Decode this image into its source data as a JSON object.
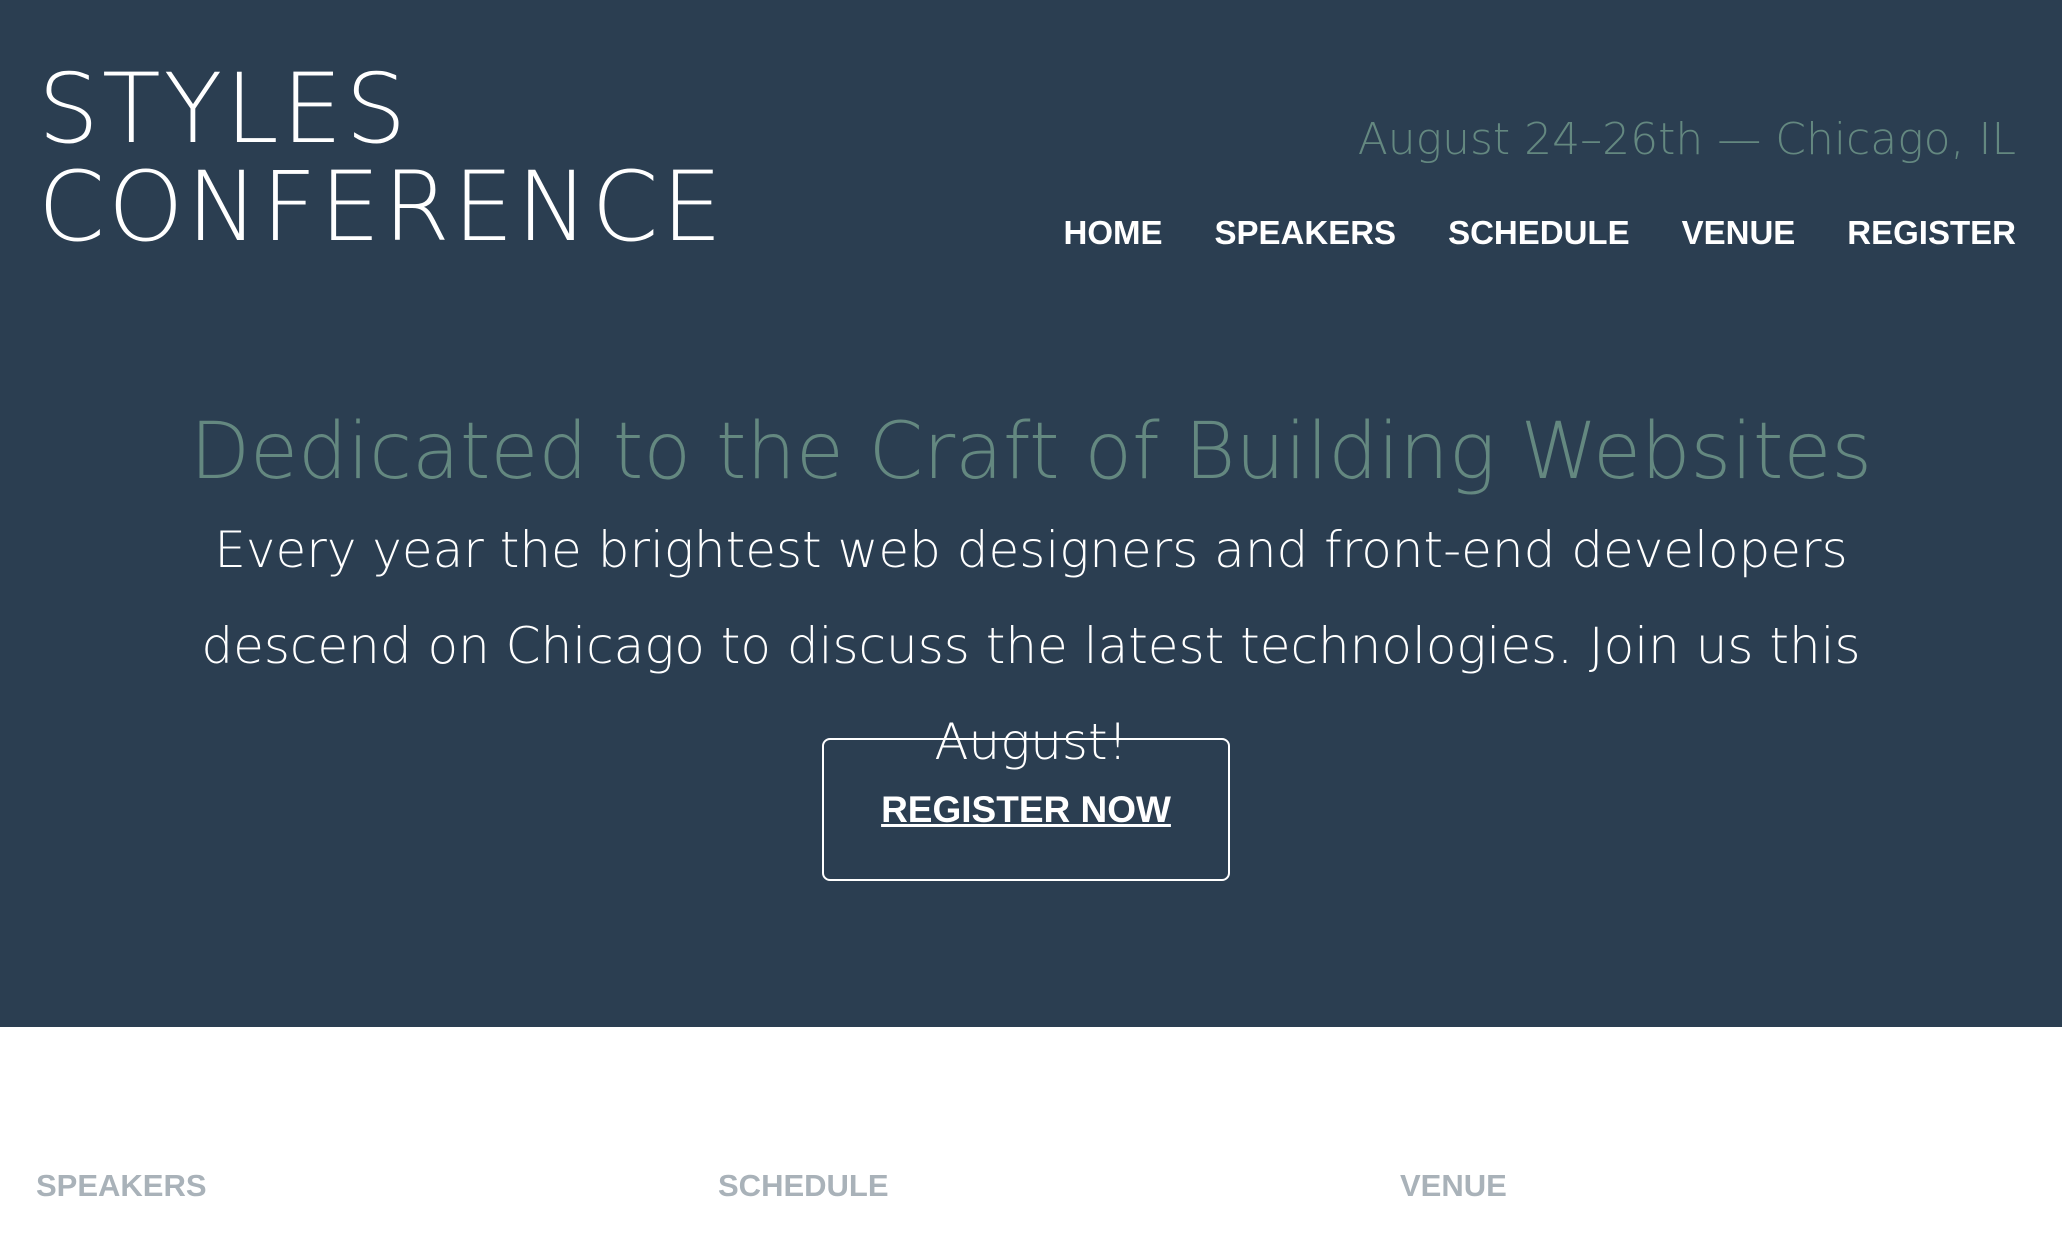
{
  "header": {
    "logo": {
      "line1": "STYLES",
      "line2": "CONFERENCE"
    },
    "tagline": "August 24–26th — Chicago, IL",
    "nav": {
      "home": "HOME",
      "speakers": "SPEAKERS",
      "schedule": "SCHEDULE",
      "venue": "VENUE",
      "register": "REGISTER"
    }
  },
  "hero": {
    "title": "Dedicated to the Craft of Building Websites",
    "text": "Every year the brightest web designers and front-end developers descend on Chicago to discuss the latest technologies. Join us this August!",
    "cta_label": "REGISTER NOW"
  },
  "teasers": {
    "speakers": "SPEAKERS",
    "schedule": "SCHEDULE",
    "venue": "VENUE"
  },
  "colors": {
    "hero_background": "#2b3e51",
    "accent_green": "#648880",
    "text_white": "#ffffff",
    "muted_gray": "#a9b2b9"
  }
}
